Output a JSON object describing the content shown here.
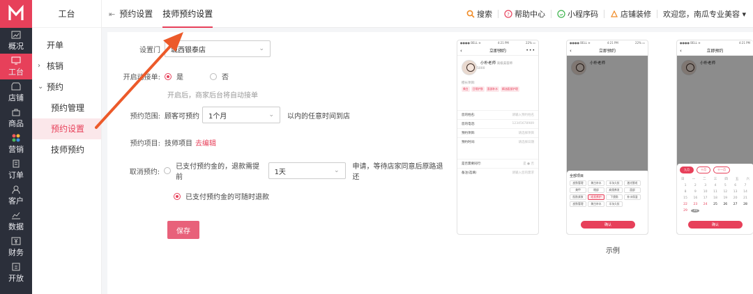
{
  "rail": {
    "items": [
      {
        "label": "概况",
        "icon": "chart-icon"
      },
      {
        "label": "工台",
        "icon": "monitor-icon",
        "active": true
      },
      {
        "label": "店铺",
        "icon": "store-icon"
      },
      {
        "label": "商品",
        "icon": "bag-icon"
      },
      {
        "label": "营销",
        "icon": "grid-icon"
      },
      {
        "label": "订单",
        "icon": "order-icon"
      },
      {
        "label": "客户",
        "icon": "user-icon"
      },
      {
        "label": "数据",
        "icon": "data-icon"
      },
      {
        "label": "财务",
        "icon": "finance-icon"
      },
      {
        "label": "开放",
        "icon": "open-icon"
      }
    ]
  },
  "sidebar": {
    "title": "工台",
    "items": [
      {
        "label": "开单"
      },
      {
        "label": "核销",
        "chevron": "›"
      },
      {
        "label": "预约",
        "chevron": "⌄"
      },
      {
        "label": "预约管理"
      },
      {
        "label": "预约设置",
        "active": true
      },
      {
        "label": "技师预约"
      }
    ]
  },
  "topbar": {
    "tabs": [
      "预约设置",
      "技师预约设置"
    ],
    "active_tab": 1,
    "tools": [
      "搜索",
      "帮助中心",
      "小程序码",
      "店铺装修"
    ],
    "welcome": "欢迎您，南瓜专业美容 ▾"
  },
  "form": {
    "store": {
      "label": "设置门",
      "value": "城西银泰店"
    },
    "auto_accept": {
      "label": "开启动接单:",
      "yes": "是",
      "no": "否",
      "hint": "开启后，商家后台将自动接单"
    },
    "range": {
      "label": "预约范围:",
      "prefix": "顾客可预约",
      "value": "1个月",
      "suffix": "以内的任意时间到店"
    },
    "items": {
      "label": "预约项目:",
      "value": "技师项目",
      "link": "去编辑"
    },
    "cancel": {
      "label": "取消预约:",
      "opt1_prefix": "已支付预约金的，退款需提前",
      "opt1_value": "1天",
      "opt1_suffix": "申请，等待店家同意后原路退还",
      "opt2": "已支付预约金的可随时退款"
    },
    "save": "保存"
  },
  "preview": {
    "example_label": "示例",
    "status_left": "●●●● BELL ≋",
    "status_time": "4:21 PM",
    "status_right": "22% ▭",
    "nav_title": "立即预约",
    "tech_name": "小朴老师",
    "tech_title": "高级美容师",
    "tech_meta": "5000",
    "skills_label": "擅长项目:",
    "skills": [
      "美白",
      "日常护肤",
      "面部补水",
      "精油面部护理"
    ],
    "fields": [
      {
        "k": "您的姓名:",
        "v": "请输入预约姓名"
      },
      {
        "k": "您的电话:",
        "v": "12345678989"
      },
      {
        "k": "预约项目:",
        "v": "请选择项目"
      },
      {
        "k": "预约时间:",
        "v": "请选择日期"
      },
      {
        "k": "是否需要同行:",
        "v": "是 ● 否"
      },
      {
        "k": "备注(选填)",
        "v": "请输入您的需求"
      }
    ],
    "sheet_title": "全部项目",
    "chips": [
      "皮肤管理",
      "美白补水",
      "半永久妆",
      "激光脱毛",
      "美甲",
      "眼部",
      "肩颈养发",
      "面部",
      "肌肤紧致",
      "毛发养护",
      "下颌角",
      "补水保湿",
      "皮肤管理",
      "美白补水",
      "半永久妆"
    ],
    "confirm": "确认",
    "months": [
      "九月",
      "十月",
      "十一月"
    ],
    "weekdays": [
      "日",
      "一",
      "二",
      "三",
      "四",
      "五",
      "六"
    ],
    "cal_rows": [
      [
        "1",
        "2",
        "3",
        "4",
        "5",
        "6",
        "7"
      ],
      [
        "8",
        "9",
        "10",
        "11",
        "12",
        "13",
        "14"
      ],
      [
        "15",
        "16",
        "17",
        "18",
        "19",
        "20",
        "21"
      ],
      [
        "22",
        "23",
        "24",
        "25",
        "26",
        "27",
        "28"
      ],
      [
        "29",
        "30",
        "",
        "",
        "",
        "",
        ""
      ]
    ],
    "colors": {
      "accent": "#e7405a",
      "rail": "#2b2f3a"
    }
  }
}
